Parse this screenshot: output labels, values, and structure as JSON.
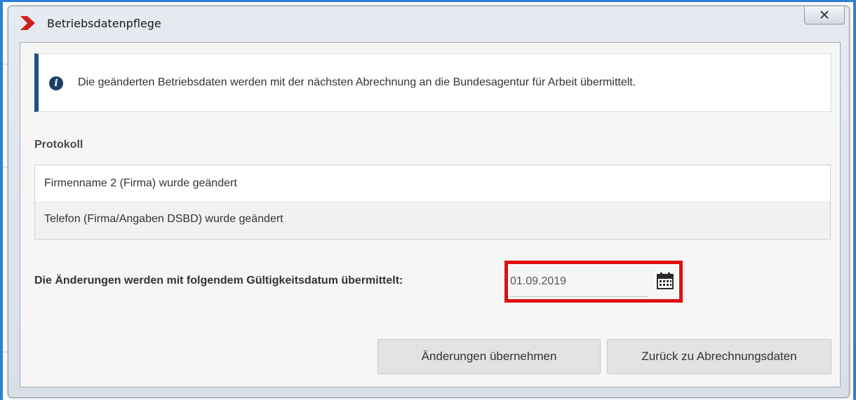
{
  "window": {
    "title": "Betriebsdatenpflege",
    "close_glyph": "X"
  },
  "info": {
    "icon": "info-icon",
    "text": "Die geänderten Betriebsdaten werden mit der nächsten Abrechnung an die Bundesagentur für Arbeit übermittelt."
  },
  "protocol": {
    "heading": "Protokoll",
    "entries": [
      "Firmenname 2 (Firma) wurde geändert",
      "Telefon (Firma/Angaben DSBD) wurde geändert"
    ]
  },
  "validity": {
    "label": "Die Änderungen werden mit folgendem Gültigkeitsdatum übermittelt:",
    "date_value": "01.09.2019",
    "calendar_icon": "calendar-icon"
  },
  "actions": {
    "apply_label": "Änderungen übernehmen",
    "back_label": "Zurück zu Abrechnungsdaten"
  },
  "colors": {
    "logo_red": "#d21e1e",
    "info_accent": "#1e4f8a",
    "highlight": "#e01010",
    "screen_edge": "#2f7fd0"
  }
}
